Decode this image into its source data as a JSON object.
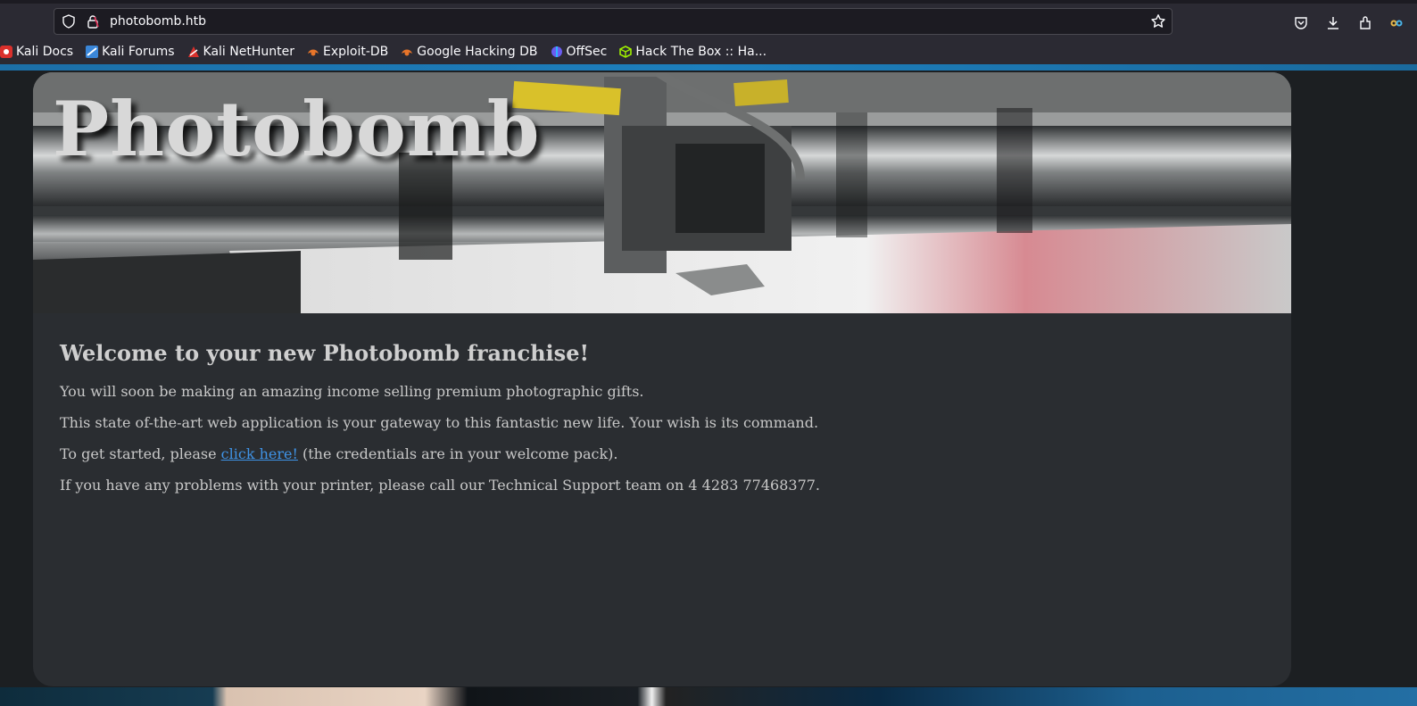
{
  "browser": {
    "url": "photobomb.htb",
    "bookmarks": [
      {
        "label": "Kali Docs",
        "icon": "kali-docs-icon",
        "color": "#d9302c"
      },
      {
        "label": "Kali Forums",
        "icon": "kali-forums-icon",
        "color": "#3a86d8"
      },
      {
        "label": "Kali NetHunter",
        "icon": "kali-nethunter-icon",
        "color": "#d9302c"
      },
      {
        "label": "Exploit-DB",
        "icon": "exploit-db-icon",
        "color": "#e8752a"
      },
      {
        "label": "Google Hacking DB",
        "icon": "google-hacking-db-icon",
        "color": "#e8752a"
      },
      {
        "label": "OffSec",
        "icon": "offsec-icon",
        "color": "#6a5cf0"
      },
      {
        "label": "Hack The Box :: Ha...",
        "icon": "hack-the-box-icon",
        "color": "#9fef00"
      }
    ]
  },
  "page": {
    "hero_title": "Photobomb",
    "heading": "Welcome to your new Photobomb franchise!",
    "para1": "You will soon be making an amazing income selling premium photographic gifts.",
    "para2": "This state of-the-art web application is your gateway to this fantastic new life. Your wish is its command.",
    "para3_before": "To get started, please ",
    "para3_link": "click here!",
    "para3_after": " (the credentials are in your welcome pack).",
    "para4": "If you have any problems with your printer, please call our Technical Support team on 4 4283 77468377."
  },
  "colors": {
    "link": "#3f93e6",
    "card_bg": "#2a2d31",
    "chrome_bg": "#2b2a33"
  }
}
